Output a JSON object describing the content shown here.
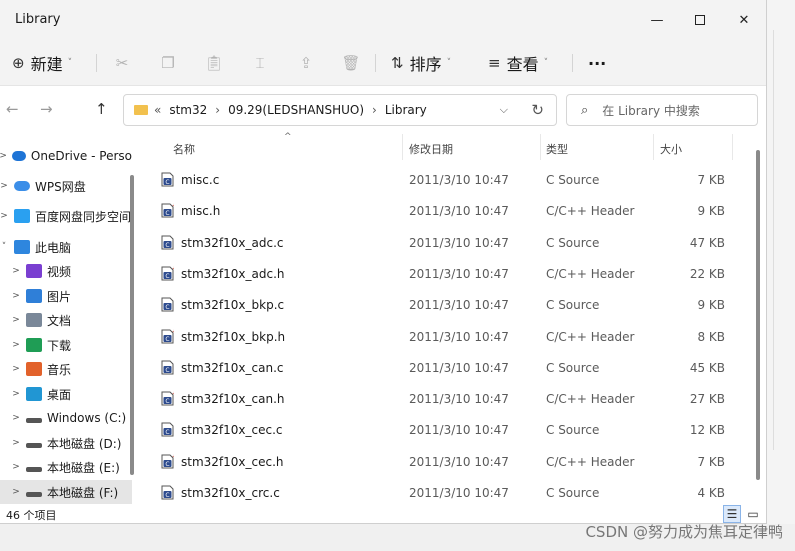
{
  "window": {
    "title": "Library"
  },
  "toolbar": {
    "new_label": "新建",
    "sort_label": "排序",
    "view_label": "查看",
    "more_label": "···"
  },
  "address": {
    "overflow": "«",
    "segments": [
      "stm32",
      "09.29(LEDSHANSHUO)",
      "Library"
    ],
    "separator": "›"
  },
  "search": {
    "placeholder": "在 Library 中搜索"
  },
  "sidebar": {
    "items": [
      {
        "label": "OneDrive - Perso",
        "icon": "cloud-icon",
        "color": "#1e74d6"
      },
      {
        "label": "WPS网盘",
        "icon": "cloud-icon",
        "color": "#3b8ee8"
      },
      {
        "label": "百度网盘同步空间",
        "icon": "baidu-icon",
        "color": "#2aa0f0"
      },
      {
        "label": "此电脑",
        "icon": "computer-icon",
        "color": "#2e86de"
      },
      {
        "label": "视频",
        "icon": "video-icon",
        "color": "#7a3fd1"
      },
      {
        "label": "图片",
        "icon": "pictures-icon",
        "color": "#2f7fd8"
      },
      {
        "label": "文档",
        "icon": "documents-icon",
        "color": "#7a8899"
      },
      {
        "label": "下载",
        "icon": "download-icon",
        "color": "#1f9d55"
      },
      {
        "label": "音乐",
        "icon": "music-icon",
        "color": "#e2622b"
      },
      {
        "label": "桌面",
        "icon": "desktop-icon",
        "color": "#2196d3"
      },
      {
        "label": "Windows (C:)",
        "icon": "drive-icon",
        "color": "#555555"
      },
      {
        "label": "本地磁盘 (D:)",
        "icon": "drive-icon",
        "color": "#555555"
      },
      {
        "label": "本地磁盘 (E:)",
        "icon": "drive-icon",
        "color": "#555555"
      },
      {
        "label": "本地磁盘 (F:)",
        "icon": "drive-icon",
        "color": "#555555"
      }
    ]
  },
  "columns": {
    "name": "名称",
    "date": "修改日期",
    "type": "类型",
    "size": "大小"
  },
  "files": [
    {
      "name": "misc.c",
      "date": "2011/3/10 10:47",
      "type": "C Source",
      "size": "7 KB",
      "kind": "c"
    },
    {
      "name": "misc.h",
      "date": "2011/3/10 10:47",
      "type": "C/C++ Header",
      "size": "9 KB",
      "kind": "h"
    },
    {
      "name": "stm32f10x_adc.c",
      "date": "2011/3/10 10:47",
      "type": "C Source",
      "size": "47 KB",
      "kind": "c"
    },
    {
      "name": "stm32f10x_adc.h",
      "date": "2011/3/10 10:47",
      "type": "C/C++ Header",
      "size": "22 KB",
      "kind": "h"
    },
    {
      "name": "stm32f10x_bkp.c",
      "date": "2011/3/10 10:47",
      "type": "C Source",
      "size": "9 KB",
      "kind": "c"
    },
    {
      "name": "stm32f10x_bkp.h",
      "date": "2011/3/10 10:47",
      "type": "C/C++ Header",
      "size": "8 KB",
      "kind": "h"
    },
    {
      "name": "stm32f10x_can.c",
      "date": "2011/3/10 10:47",
      "type": "C Source",
      "size": "45 KB",
      "kind": "c"
    },
    {
      "name": "stm32f10x_can.h",
      "date": "2011/3/10 10:47",
      "type": "C/C++ Header",
      "size": "27 KB",
      "kind": "h"
    },
    {
      "name": "stm32f10x_cec.c",
      "date": "2011/3/10 10:47",
      "type": "C Source",
      "size": "12 KB",
      "kind": "c"
    },
    {
      "name": "stm32f10x_cec.h",
      "date": "2011/3/10 10:47",
      "type": "C/C++ Header",
      "size": "7 KB",
      "kind": "h"
    },
    {
      "name": "stm32f10x_crc.c",
      "date": "2011/3/10 10:47",
      "type": "C Source",
      "size": "4 KB",
      "kind": "c"
    }
  ],
  "status": {
    "count": "46 个项目"
  },
  "watermark": "CSDN @努力成为焦耳定律鸭"
}
